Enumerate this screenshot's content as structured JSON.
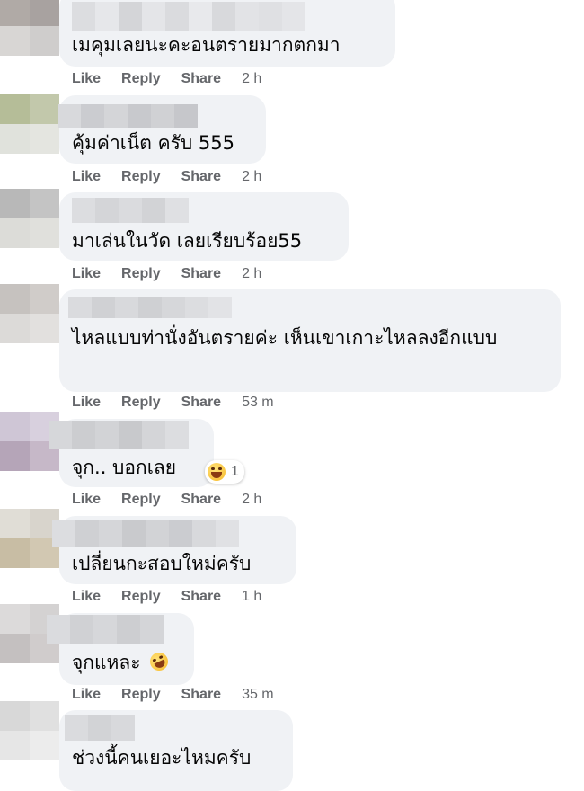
{
  "actions": {
    "like": "Like",
    "reply": "Reply",
    "share": "Share"
  },
  "comments": [
    {
      "text": "เมคุมเลยนะคะอนตรายมากตกมา",
      "time": "2 h"
    },
    {
      "text": "คุ้มค่าเน็ต ครับ 555",
      "time": "2 h"
    },
    {
      "text": "มาเล่นในวัด เลยเรียบร้อย55",
      "time": "2 h"
    },
    {
      "text": "ไหลแบบท่านั่งอันตรายค่ะ เห็นเขาเกาะไหลลงอีกแบบ",
      "time": "53 m"
    },
    {
      "text": "จุก.. บอกเลย",
      "time": "2 h",
      "reaction": {
        "icon": "haha-emoji-icon",
        "count": "1"
      }
    },
    {
      "text": "เปลี่ยนกะสอบใหม่ครับ",
      "time": "1 h"
    },
    {
      "text": "จุกแหละ",
      "emoji": "rofl-emoji-icon",
      "time": "35 m"
    },
    {
      "text": "ช่วงนี้คนเยอะไหมครับ"
    }
  ],
  "colors": {
    "bubble": "#f0f2f5",
    "meta": "#65676b",
    "text": "#050505"
  }
}
